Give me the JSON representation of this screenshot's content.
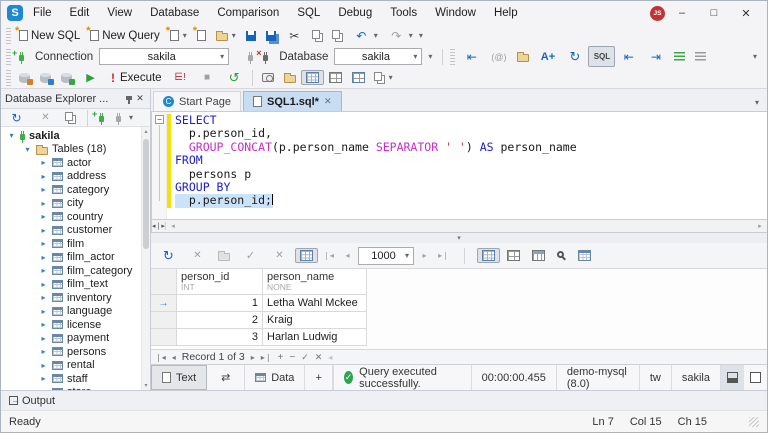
{
  "window": {
    "app_initial": "S",
    "menus": [
      "File",
      "Edit",
      "View",
      "Database",
      "Comparison",
      "SQL",
      "Debug",
      "Tools",
      "Window",
      "Help"
    ],
    "avatar": "JS",
    "controls": {
      "minimize": "–",
      "maximize": "□",
      "close": "✕"
    }
  },
  "icons": {
    "caret_down": "▾",
    "caret_up": "▴",
    "tri_right": "▸",
    "tri_left": "◂",
    "undo": "↶",
    "redo": "↷",
    "cut": "✂",
    "play": "▶",
    "stop": "■",
    "refresh": "↻",
    "history": "↺",
    "check": "✓",
    "close": "✕",
    "swap": "⇄",
    "plus": "+",
    "minus": "−",
    "bar": "|",
    "indent_left": "⇤",
    "indent_right": "⇥",
    "bang": "!",
    "at": "(@)",
    "a_plus": "A+",
    "sql_badge": "SQL",
    "x_badge": "×",
    "pencil_dot": "",
    "row_arrow": "→"
  },
  "toolbar_file": {
    "new_sql": "New SQL",
    "new_query": "New Query"
  },
  "toolbar_connection": {
    "connection_label": "Connection",
    "connection_value": "sakila",
    "database_label": "Database",
    "database_value": "sakila"
  },
  "toolbar_execute": {
    "execute_label": "Execute"
  },
  "explorer": {
    "title": "Database Explorer ...",
    "connection": "sakila",
    "tables_group": "Tables (18)",
    "tables": [
      "actor",
      "address",
      "category",
      "city",
      "country",
      "customer",
      "film",
      "film_actor",
      "film_category",
      "film_text",
      "inventory",
      "language",
      "license",
      "payment",
      "persons",
      "rental",
      "staff",
      "store"
    ]
  },
  "tabs": {
    "start_page": "Start Page",
    "sql_doc": "SQL1.sql*"
  },
  "editor": {
    "lines": [
      {
        "tokens": [
          {
            "c": "kw",
            "v": "SELECT"
          }
        ]
      },
      {
        "tokens": [
          {
            "c": "pl",
            "v": "  p.person_id,"
          }
        ]
      },
      {
        "tokens": [
          {
            "c": "pl",
            "v": "  "
          },
          {
            "c": "fn",
            "v": "GROUP_CONCAT"
          },
          {
            "c": "pl",
            "v": "(p.person_name "
          },
          {
            "c": "fn",
            "v": "SEPARATOR"
          },
          {
            "c": "pl",
            "v": " "
          },
          {
            "c": "str",
            "v": "' '"
          },
          {
            "c": "pl",
            "v": ") "
          },
          {
            "c": "kw",
            "v": "AS"
          },
          {
            "c": "pl",
            "v": " person_name"
          }
        ]
      },
      {
        "tokens": [
          {
            "c": "kw",
            "v": "FROM"
          }
        ]
      },
      {
        "tokens": [
          {
            "c": "pl",
            "v": "  persons p"
          }
        ]
      },
      {
        "tokens": [
          {
            "c": "kw",
            "v": "GROUP BY"
          }
        ]
      },
      {
        "tokens": [
          {
            "c": "pl",
            "v": "  p.person_id;"
          }
        ]
      }
    ]
  },
  "results": {
    "page_size": "1000",
    "columns": [
      {
        "name": "person_id",
        "type": "INT"
      },
      {
        "name": "person_name",
        "type": "NONE"
      }
    ],
    "rows": [
      {
        "id": "1",
        "name": "Letha Wahl Mckee"
      },
      {
        "id": "2",
        "name": "Kraig"
      },
      {
        "id": "3",
        "name": "Harlan Ludwig"
      }
    ],
    "record_label": "Record 1 of 3"
  },
  "bottom_bar": {
    "text_tab": "Text",
    "data_tab": "Data",
    "add_tab": "+",
    "status_message": "Query executed successfully.",
    "duration": "00:00:00.455",
    "server": "demo-mysql (8.0)",
    "user": "tw",
    "database": "sakila"
  },
  "output_panel": {
    "label": "Output"
  },
  "status_bar": {
    "state": "Ready",
    "line": "Ln 7",
    "column": "Col 15",
    "char": "Ch 15"
  }
}
